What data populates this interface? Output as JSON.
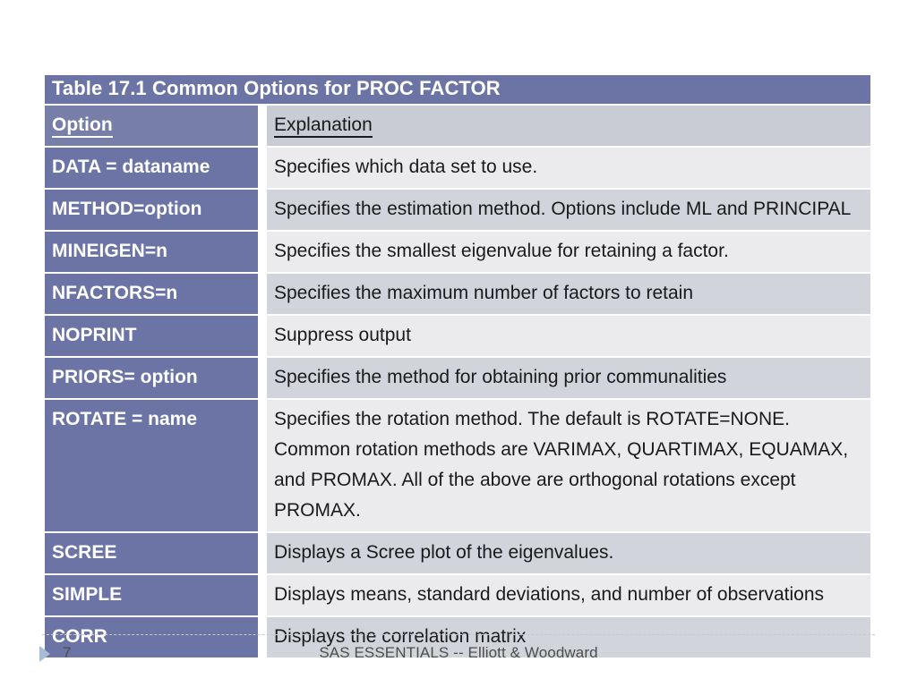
{
  "slide": {
    "page_number": "7",
    "footer_text": "SAS ESSENTIALS -- Elliott & Woodward",
    "marker_icon": "play-triangle-icon"
  },
  "table": {
    "title": "Table 17.1 Common Options for PROC FACTOR",
    "headers": {
      "option": "Option",
      "explanation": "Explanation"
    },
    "accent_color": "#6b74a4",
    "row_shade_dark": "#d1d4db",
    "row_shade_light": "#ebebee",
    "rows": [
      {
        "option": "DATA = dataname",
        "explanation": "Specifies which data set to use.",
        "shade": "light"
      },
      {
        "option": "METHOD=option",
        "explanation": "Specifies the estimation method. Options include ML and PRINCIPAL",
        "shade": "dark"
      },
      {
        "option": "MINEIGEN=n",
        "explanation": "Specifies the smallest eigenvalue for retaining a factor.",
        "shade": "light"
      },
      {
        "option": "NFACTORS=n",
        "explanation": "Specifies the maximum number of factors to retain",
        "shade": "dark"
      },
      {
        "option": "NOPRINT",
        "explanation": "Suppress output",
        "shade": "light"
      },
      {
        "option": "PRIORS= option",
        "explanation": "Specifies the method for obtaining prior communalities",
        "shade": "dark"
      },
      {
        "option": "ROTATE = name",
        "explanation": "Specifies the rotation method. The default is ROTATE=NONE. Common rotation methods are VARIMAX, QUARTIMAX, EQUAMAX, and PROMAX.  All of the above are orthogonal rotations except PROMAX.",
        "shade": "light"
      },
      {
        "option": "SCREE",
        "explanation": "Displays a Scree plot of the eigenvalues.",
        "shade": "dark"
      },
      {
        "option": "SIMPLE",
        "explanation": "Displays means, standard deviations, and number of observations",
        "shade": "light"
      },
      {
        "option": "CORR",
        "explanation": "Displays the correlation matrix",
        "shade": "dark"
      }
    ]
  }
}
